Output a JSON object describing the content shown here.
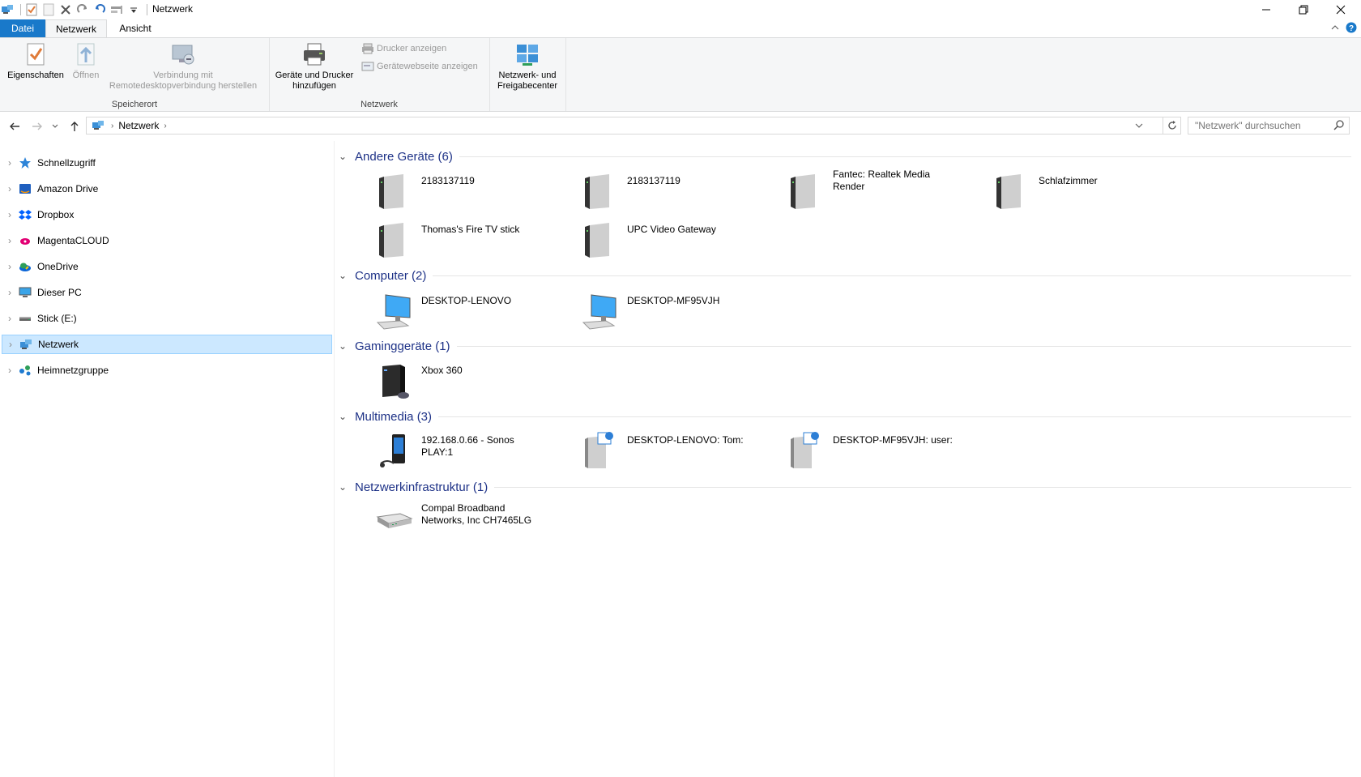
{
  "window": {
    "title": "Netzwerk"
  },
  "tabs": {
    "datei": "Datei",
    "netzwerk": "Netzwerk",
    "ansicht": "Ansicht"
  },
  "ribbon": {
    "eigenschaften": "Eigenschaften",
    "oeffnen": "Öffnen",
    "remote_line1": "Verbindung mit",
    "remote_line2": "Remotedesktopverbindung herstellen",
    "group_speicherort": "Speicherort",
    "geraete_line1": "Geräte und Drucker",
    "geraete_line2": "hinzufügen",
    "drucker_anzeigen": "Drucker anzeigen",
    "geraetewebseite": "Gerätewebseite anzeigen",
    "group_netzwerk": "Netzwerk",
    "freigabe_line1": "Netzwerk- und",
    "freigabe_line2": "Freigabecenter"
  },
  "address": {
    "crumb": "Netzwerk",
    "search_placeholder": "\"Netzwerk\" durchsuchen"
  },
  "nav": {
    "items": [
      {
        "label": "Schnellzugriff",
        "icon": "star-icon"
      },
      {
        "label": "Amazon Drive",
        "icon": "amazon-drive-icon"
      },
      {
        "label": "Dropbox",
        "icon": "dropbox-icon"
      },
      {
        "label": "MagentaCLOUD",
        "icon": "magenta-cloud-icon"
      },
      {
        "label": "OneDrive",
        "icon": "onedrive-icon"
      },
      {
        "label": "Dieser PC",
        "icon": "pc-icon"
      },
      {
        "label": "Stick (E:)",
        "icon": "drive-icon"
      },
      {
        "label": "Netzwerk",
        "icon": "network-icon"
      },
      {
        "label": "Heimnetzgruppe",
        "icon": "homegroup-icon"
      }
    ]
  },
  "groups": {
    "andere": {
      "header": "Andere Geräte (6)",
      "items": [
        "2183137119",
        "2183137119",
        "Fantec: Realtek Media Render",
        "Schlafzimmer",
        "Thomas's Fire TV stick",
        "UPC Video Gateway"
      ]
    },
    "computer": {
      "header": "Computer (2)",
      "items": [
        "DESKTOP-LENOVO",
        "DESKTOP-MF95VJH"
      ]
    },
    "gaming": {
      "header": "Gaminggeräte (1)",
      "items": [
        "Xbox 360"
      ]
    },
    "multimedia": {
      "header": "Multimedia (3)",
      "items": [
        "192.168.0.66 - Sonos PLAY:1",
        "DESKTOP-LENOVO: Tom:",
        "DESKTOP-MF95VJH: user:"
      ]
    },
    "infra": {
      "header": "Netzwerkinfrastruktur (1)",
      "items": [
        "Compal Broadband Networks, Inc CH7465LG"
      ]
    }
  },
  "colors": {
    "accent": "#1979ca",
    "group_header": "#1e3287",
    "selection": "#cce8ff"
  }
}
